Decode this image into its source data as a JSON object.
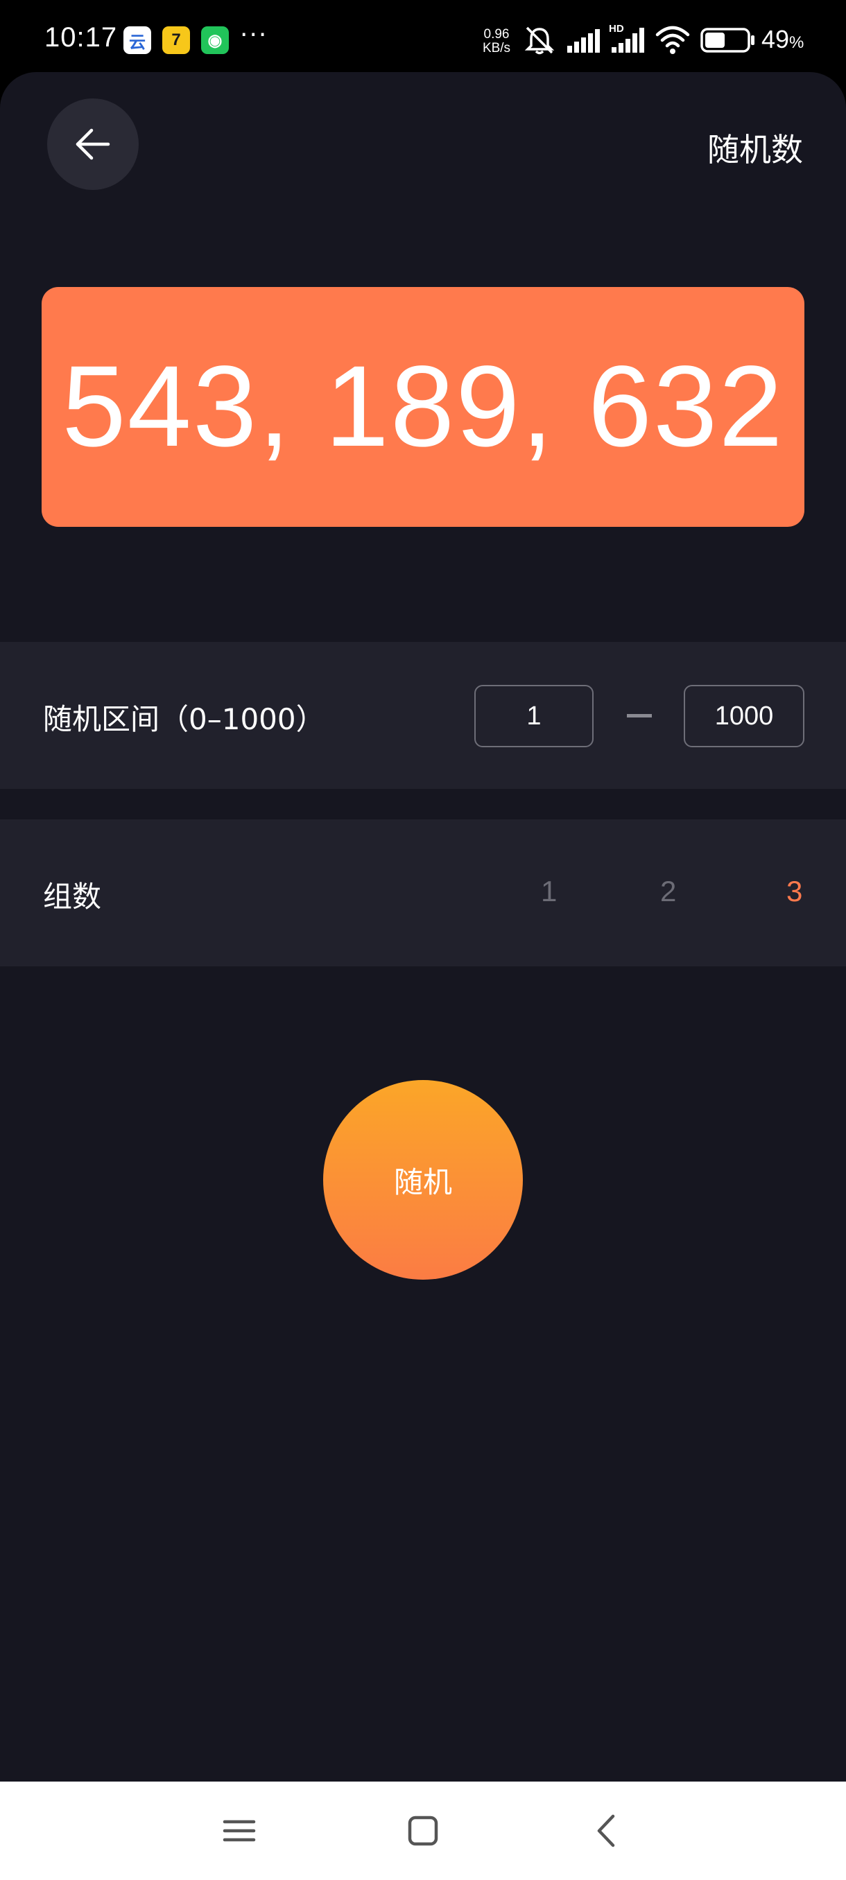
{
  "status_bar": {
    "time": "10:17",
    "app_icons": [
      {
        "name": "cloud-app-icon",
        "glyph": "云"
      },
      {
        "name": "taobao-app-icon",
        "glyph": "7"
      },
      {
        "name": "wechat-app-icon",
        "glyph": "◉"
      }
    ],
    "more": "···",
    "net_speed_value": "0.96",
    "net_speed_unit": "KB/s",
    "battery_level": 0.49,
    "battery_text": "49",
    "battery_unit": "%"
  },
  "header": {
    "title": "随机数"
  },
  "result": {
    "value": "543, 189, 632"
  },
  "range": {
    "label": "随机区间（0–1000）",
    "min": "1",
    "max": "1000"
  },
  "groups": {
    "label": "组数",
    "options": [
      "1",
      "2",
      "3"
    ],
    "selected": "3",
    "accent_color": "#ff7a4d"
  },
  "action": {
    "label": "随机"
  },
  "colors": {
    "accent": "#ff7a4d",
    "background": "#161620",
    "row_background": "#21212c"
  }
}
